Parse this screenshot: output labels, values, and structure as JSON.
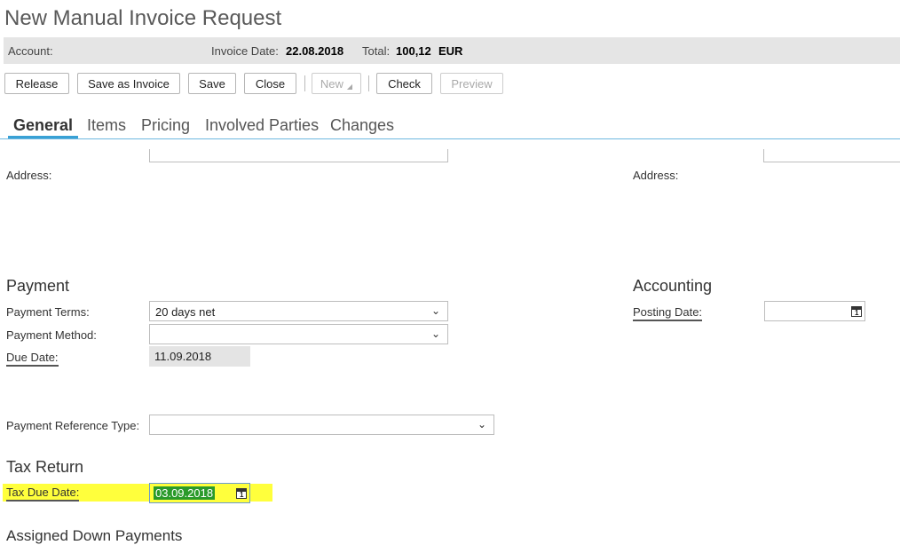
{
  "page": {
    "title": "New Manual Invoice Request"
  },
  "infobar": {
    "account_label": "Account:",
    "invoice_date_label": "Invoice Date:",
    "invoice_date_value": "22.08.2018",
    "total_label": "Total:",
    "total_value": "100,12",
    "currency": "EUR"
  },
  "toolbar": {
    "release": "Release",
    "save_as_invoice": "Save as Invoice",
    "save": "Save",
    "close": "Close",
    "new": "New",
    "check": "Check",
    "preview": "Preview"
  },
  "tabs": [
    {
      "label": "General",
      "active": true
    },
    {
      "label": "Items"
    },
    {
      "label": "Pricing"
    },
    {
      "label": "Involved Parties"
    },
    {
      "label": "Changes"
    }
  ],
  "address": {
    "left_label": "Address:",
    "right_label": "Address:"
  },
  "payment": {
    "title": "Payment",
    "terms_label": "Payment Terms:",
    "terms_value": "20 days net",
    "method_label": "Payment Method:",
    "method_value": "",
    "due_date_label": "Due Date:",
    "due_date_value": "11.09.2018",
    "ref_type_label": "Payment Reference Type:",
    "ref_type_value": ""
  },
  "accounting": {
    "title": "Accounting",
    "posting_date_label": "Posting Date:",
    "posting_date_value": ""
  },
  "tax_return": {
    "title": "Tax Return",
    "tax_due_date_label": "Tax Due Date:",
    "tax_due_date_value": "03.09.2018"
  },
  "down_payments": {
    "title": "Assigned Down Payments"
  },
  "colors": {
    "highlight": "#ffff3c",
    "tab_accent": "#39a1d5",
    "selection": "#2a9a2a"
  },
  "icons": {
    "calendar": "calendar-icon",
    "dropdown": "chevron-down-icon"
  }
}
